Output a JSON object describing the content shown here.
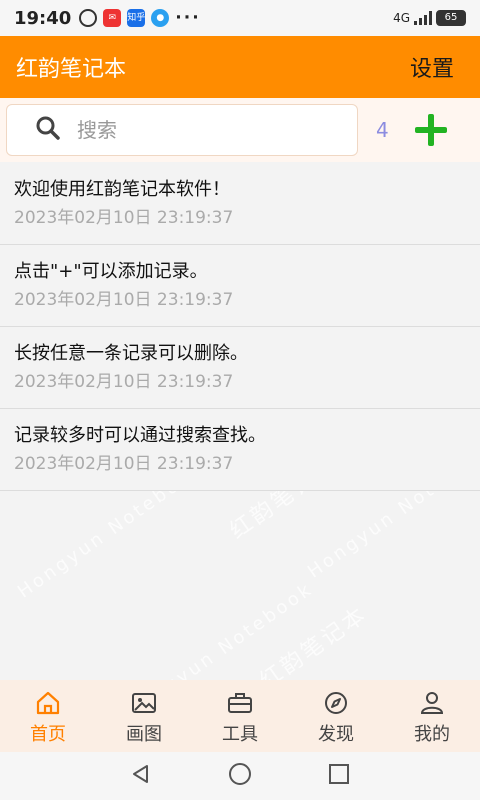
{
  "status_bar": {
    "time": "19:40",
    "app_icons": [
      "alarm-icon",
      "weibo-icon",
      "zhihu-icon",
      "messenger-icon"
    ],
    "zhihu_label": "知乎",
    "more": "···",
    "network": "4G",
    "battery": "65"
  },
  "header": {
    "title": "红韵笔记本",
    "settings_label": "设置"
  },
  "search": {
    "placeholder": "搜索",
    "value": "",
    "count": "4",
    "add_icon": "plus-icon"
  },
  "notes": [
    {
      "text": "欢迎使用红韵笔记本软件！",
      "time": "2023年02月10日 23:19:37"
    },
    {
      "text": "点击\"+\"可以添加记录。",
      "time": "2023年02月10日 23:19:37"
    },
    {
      "text": "长按任意一条记录可以删除。",
      "time": "2023年02月10日 23:19:37"
    },
    {
      "text": "记录较多时可以通过搜索查找。",
      "time": "2023年02月10日 23:19:37"
    }
  ],
  "watermark": [
    "红韵笔记本",
    "Hongyun Notebook"
  ],
  "bottom_nav": [
    {
      "label": "首页",
      "icon": "home-icon",
      "active": true
    },
    {
      "label": "画图",
      "icon": "image-icon",
      "active": false
    },
    {
      "label": "工具",
      "icon": "toolbox-icon",
      "active": false
    },
    {
      "label": "发现",
      "icon": "compass-icon",
      "active": false
    },
    {
      "label": "我的",
      "icon": "user-icon",
      "active": false
    }
  ],
  "colors": {
    "accent": "#ff8c00",
    "active_tab": "#ff8000",
    "add_button": "#22b322",
    "count": "#8c8ce0"
  }
}
